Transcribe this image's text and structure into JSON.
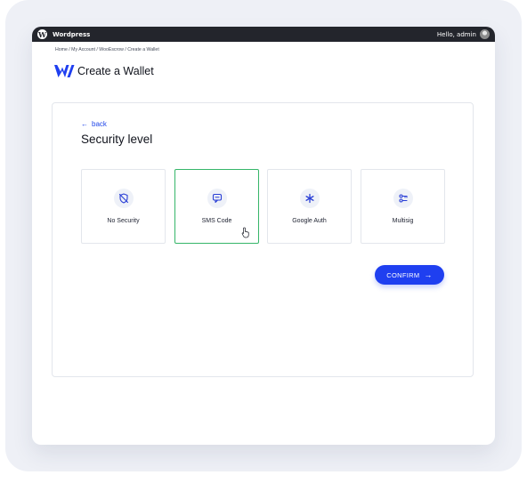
{
  "adminbar": {
    "site_name": "Wordpress",
    "greeting": "Hello, admin",
    "logo_letter": "W"
  },
  "breadcrumb": "Home / My Account / WooEscrow / Create a Wallet",
  "page": {
    "title": "Create a Wallet",
    "logo_icon": "wooescrow-logo-icon"
  },
  "card": {
    "back_label": "back",
    "back_arrow": "←",
    "title": "Security level",
    "options": [
      {
        "label": "No Security",
        "icon": "shield-off-icon",
        "selected": false
      },
      {
        "label": "SMS Code",
        "icon": "sms-chat-icon",
        "selected": true
      },
      {
        "label": "Google Auth",
        "icon": "asterisk-icon",
        "selected": false
      },
      {
        "label": "Multisig",
        "icon": "multisig-key-icon",
        "selected": false
      }
    ],
    "confirm_label": "CONFIRM",
    "confirm_arrow": "→"
  },
  "colors": {
    "accent": "#1f3ff0",
    "link": "#2248ea",
    "selected_border": "#36b669",
    "adminbar": "#23252c"
  }
}
